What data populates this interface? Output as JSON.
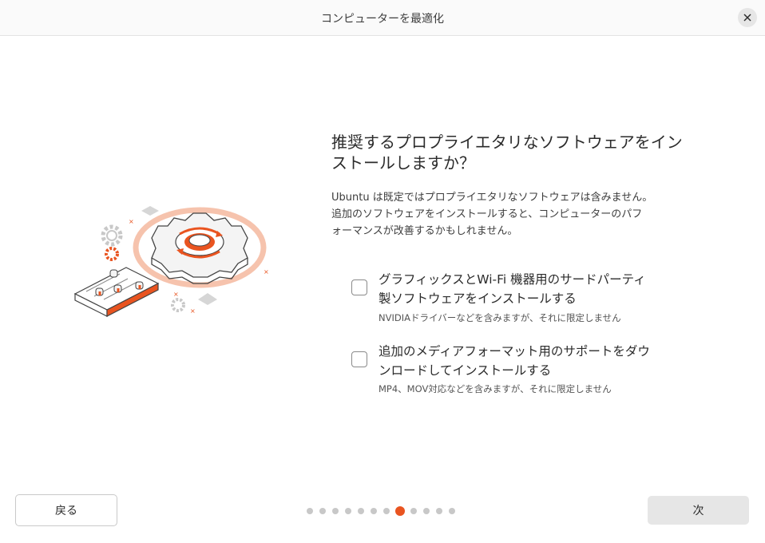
{
  "window": {
    "title": "コンピューターを最適化"
  },
  "main": {
    "heading_line1": "推奨するプロプライエタリなソフトウェアをイン",
    "heading_line2": "ストールしますか？",
    "description_line1": "Ubuntu は既定ではプロプライエタリなソフトウェアは含みません。",
    "description_line2": "追加のソフトウェアをインストールすると、コンピューターのパフ",
    "description_line3": "ォーマンスが改善するかもしれません。"
  },
  "options": [
    {
      "label_line1": "グラフィックスとWi-Fi 機器用のサードパーティ",
      "label_line2": "製ソフトウェアをインストールする",
      "sublabel": "NVIDIAドライバーなどを含みますが、それに限定しません",
      "checked": false
    },
    {
      "label_line1": "追加のメディアフォーマット用のサポートをダウ",
      "label_line2": "ンロードしてインストールする",
      "sublabel": "MP4、MOV対応などを含みますが、それに限定しません",
      "checked": false
    }
  ],
  "footer": {
    "back_label": "戻る",
    "next_label": "次",
    "page_count": 12,
    "active_page": 8
  },
  "colors": {
    "accent": "#e95420",
    "accent_light": "#f6c3ad"
  },
  "icons": [
    "close-icon",
    "gear-illustration-icon"
  ]
}
